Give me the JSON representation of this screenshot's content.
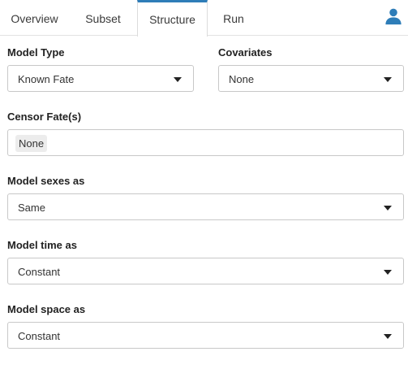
{
  "tabs": [
    {
      "label": "Overview"
    },
    {
      "label": "Subset"
    },
    {
      "label": "Structure"
    },
    {
      "label": "Run"
    }
  ],
  "active_tab": "Structure",
  "user_icon": "user-icon",
  "accent_color": "#2e7db8",
  "fields": {
    "model_type": {
      "label": "Model Type",
      "value": "Known Fate"
    },
    "covariates": {
      "label": "Covariates",
      "value": "None"
    },
    "censor_fates": {
      "label": "Censor Fate(s)",
      "value": "None"
    },
    "model_sexes": {
      "label": "Model sexes as",
      "value": "Same"
    },
    "model_time": {
      "label": "Model time as",
      "value": "Constant"
    },
    "model_space": {
      "label": "Model space as",
      "value": "Constant"
    }
  }
}
